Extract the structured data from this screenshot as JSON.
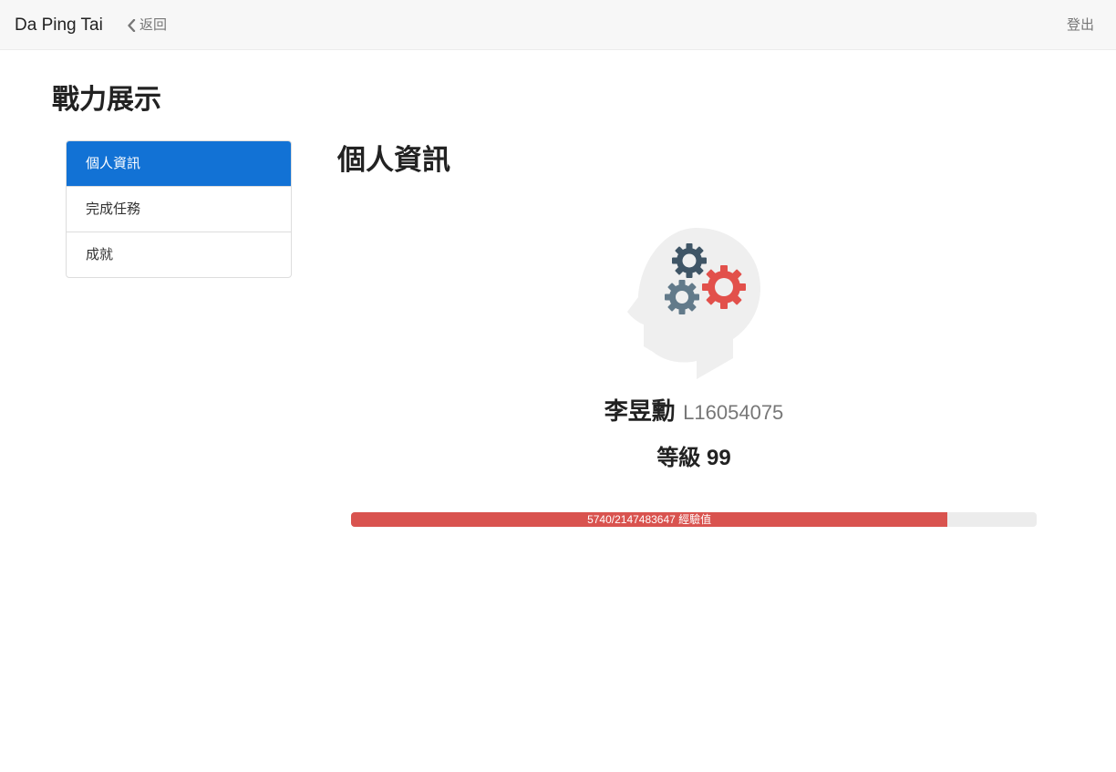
{
  "navbar": {
    "brand": "Da Ping Tai",
    "back_label": "返回",
    "logout_label": "登出"
  },
  "page": {
    "title": "戰力展示"
  },
  "sidebar": {
    "items": [
      {
        "label": "個人資訊",
        "active": true
      },
      {
        "label": "完成任務",
        "active": false
      },
      {
        "label": "成就",
        "active": false
      }
    ]
  },
  "profile": {
    "section_title": "個人資訊",
    "avatar_icon": "head-gears-icon",
    "name": "李昱勳",
    "student_id": "L16054075",
    "level_text": "等級 99",
    "experience": {
      "label": "5740/2147483647 經驗值",
      "fill_fraction": 0.87,
      "bar_color": "#d9534f"
    }
  },
  "colors": {
    "accent": "#1272d5",
    "progress_fill": "#d9534f",
    "progress_track": "#ececec",
    "gear_dark": "#3f5566",
    "gear_red": "#e2504b",
    "gear_gray": "#627a8a"
  }
}
